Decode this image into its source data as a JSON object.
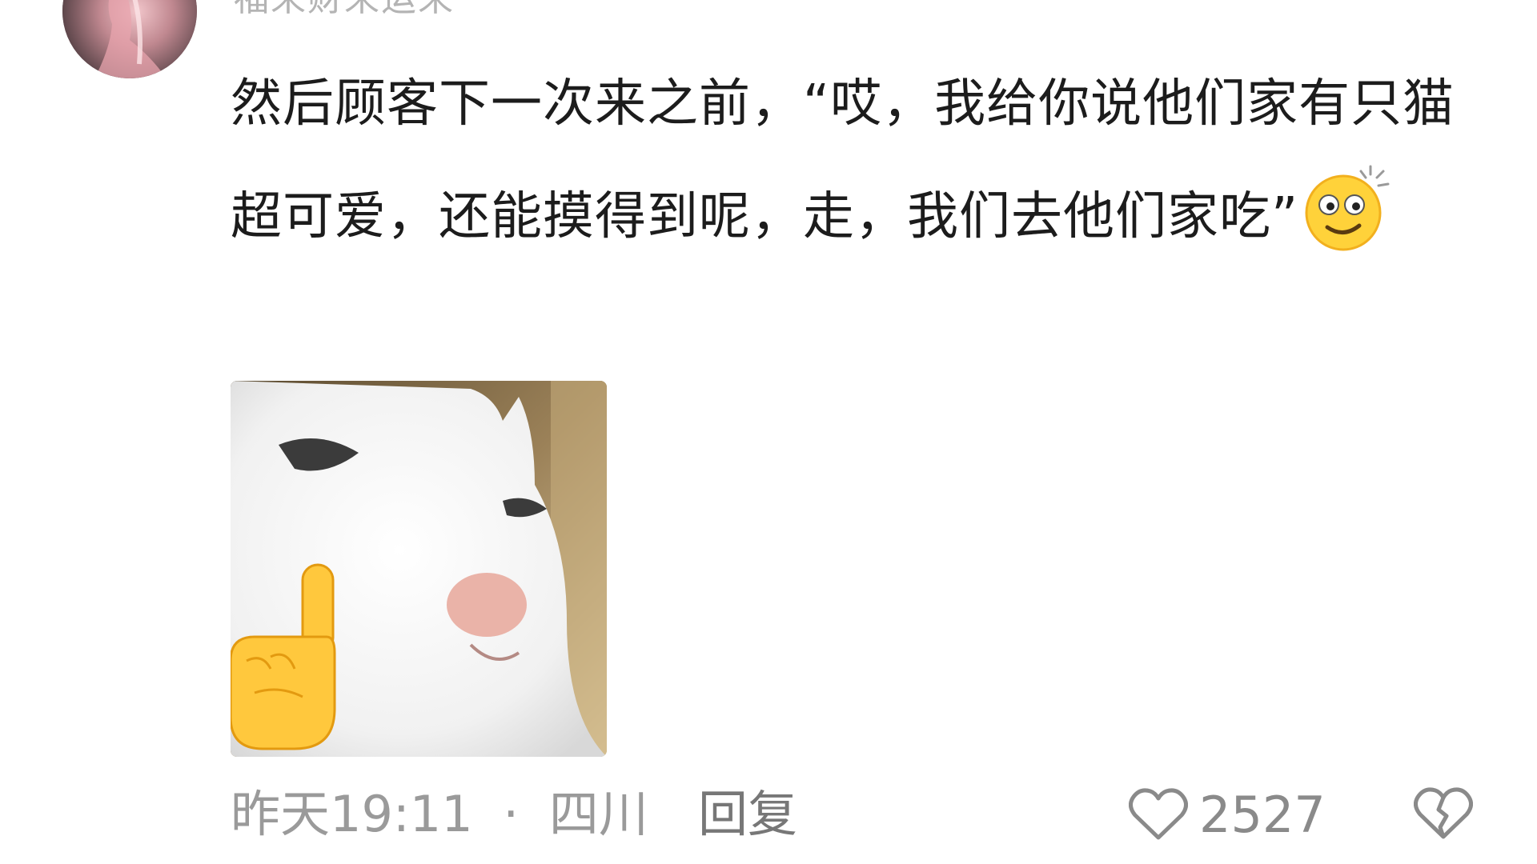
{
  "comment": {
    "username": "福来财来运来",
    "text": "然后顾客下一次来之前，“哎，我给你说他们家有只猫超可爱，还能摸得到呢，走，我们去他们家吃”",
    "inline_emoji": "dizzy-face-emoji",
    "image": "white-cat-pointing-meme"
  },
  "footer": {
    "time": "昨天19:11",
    "separator": "·",
    "location": "四川",
    "reply_label": "回复",
    "like_count": "2527",
    "like_icon": "heart-outline-icon",
    "dislike_icon": "broken-heart-icon"
  },
  "colors": {
    "text": "#1c1c1c",
    "meta": "#9a9a9a",
    "background": "#ffffff"
  }
}
